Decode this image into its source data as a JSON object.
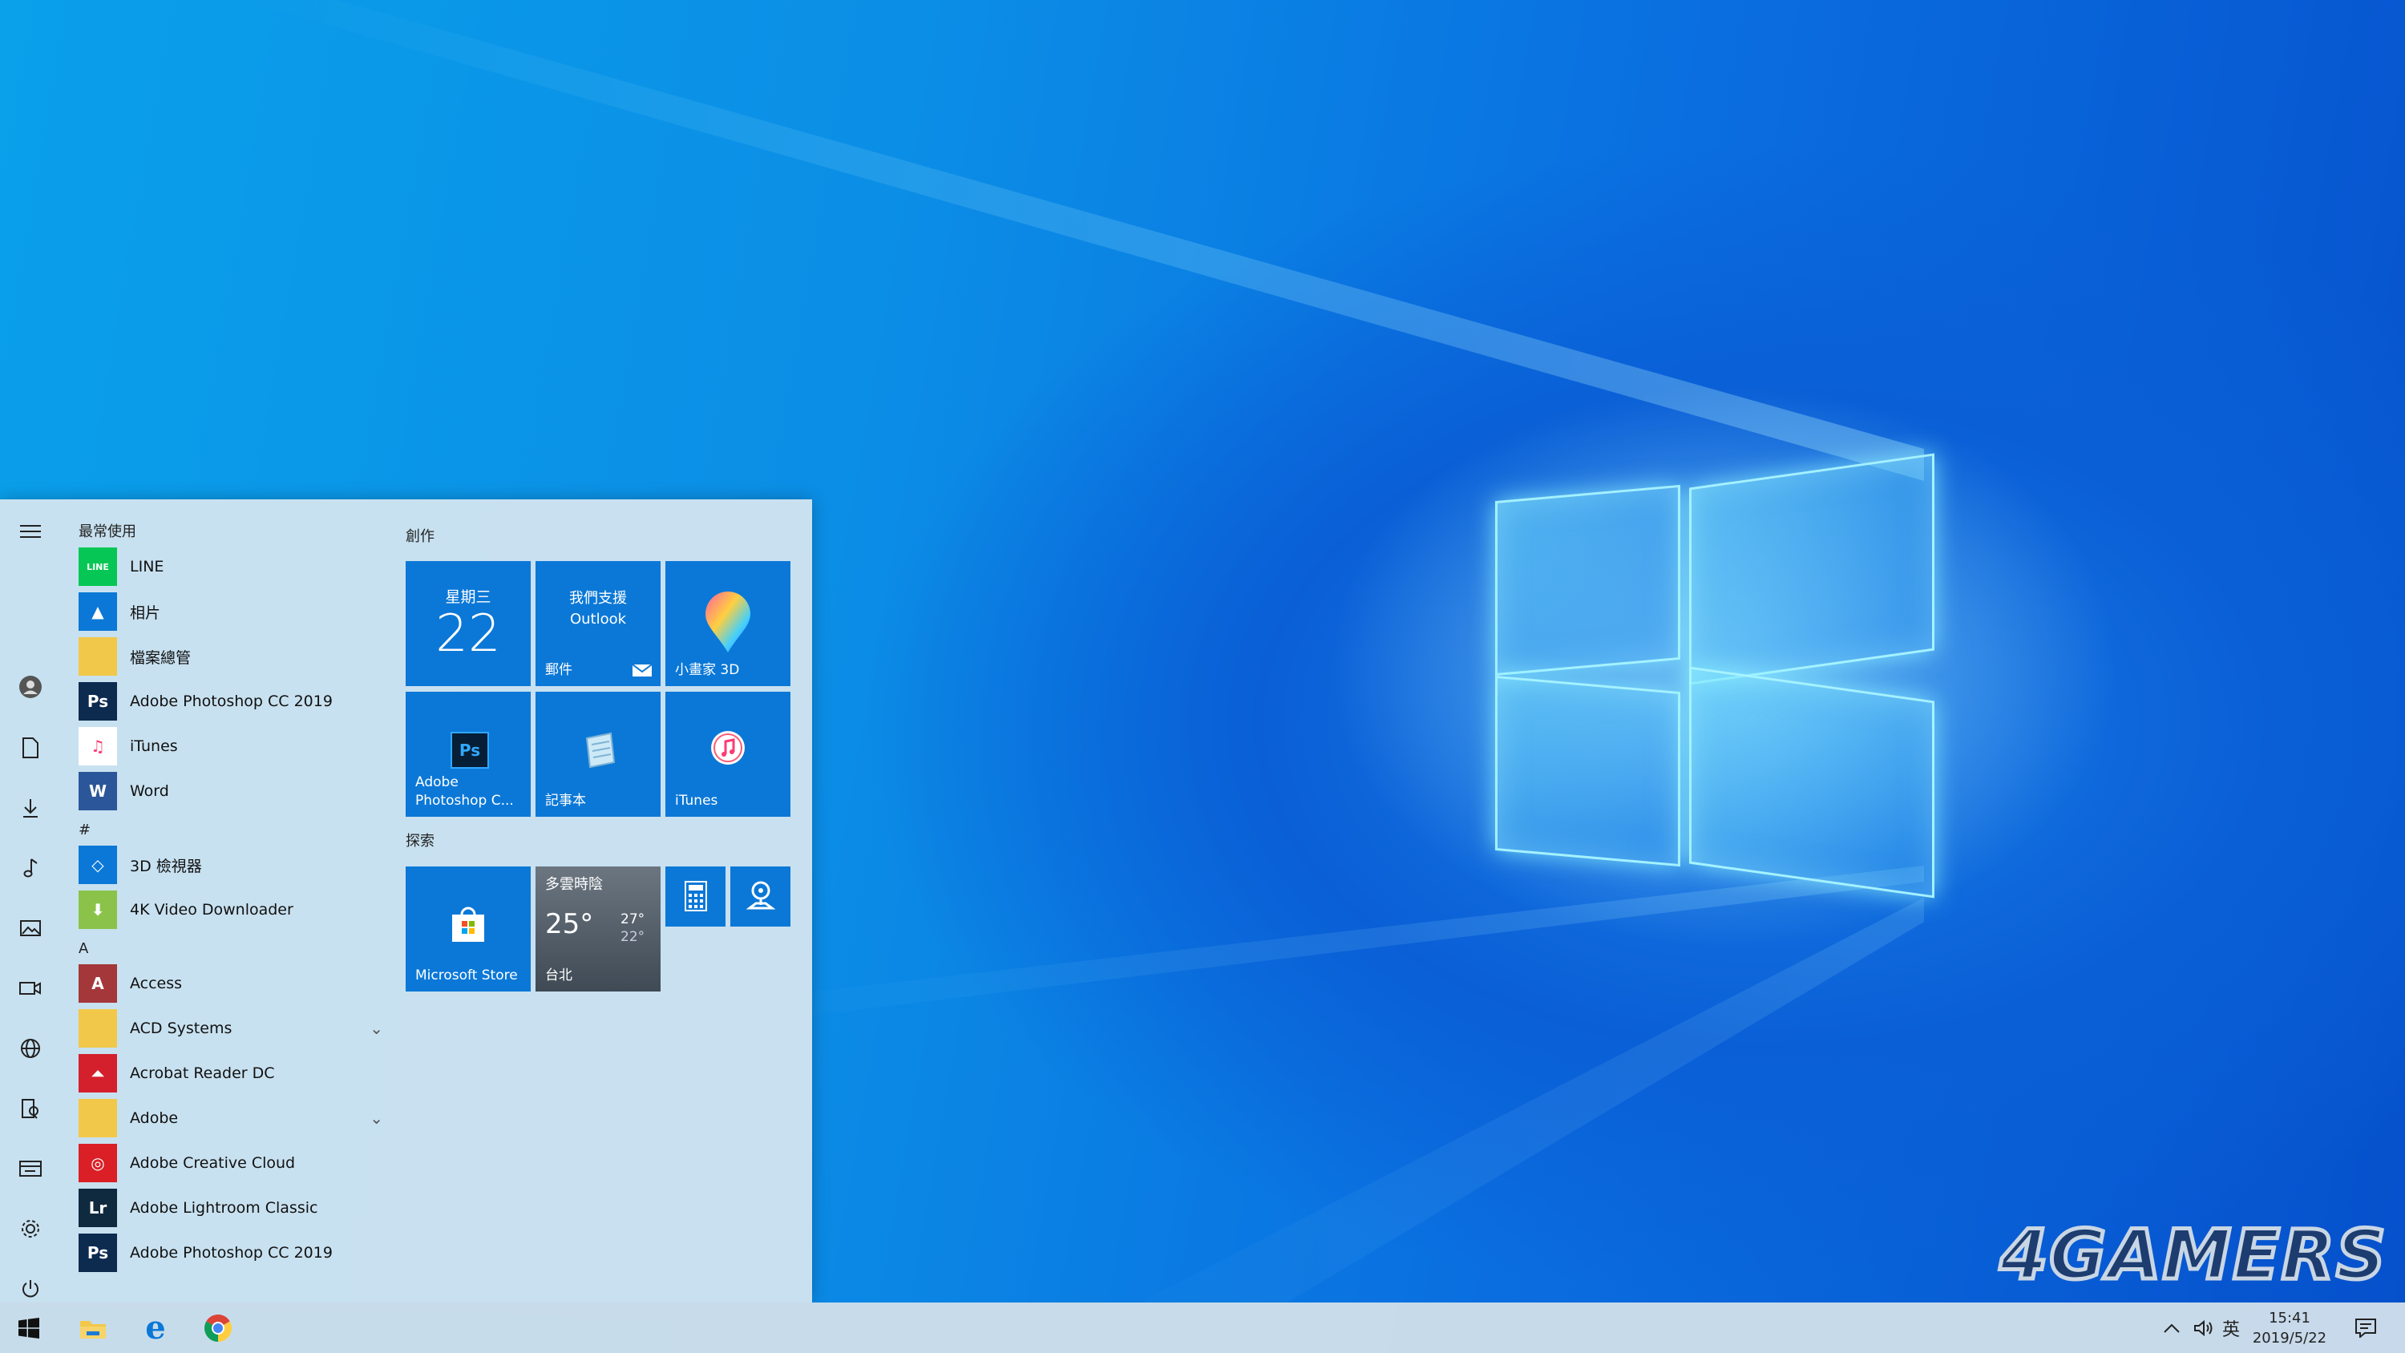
{
  "start_menu": {
    "most_used_header": "最常使用",
    "most_used": [
      {
        "label": "LINE",
        "icon": "line-icon",
        "color": "#06c755"
      },
      {
        "label": "相片",
        "icon": "photos-icon",
        "color": "#0b78d7"
      },
      {
        "label": "檔案總管",
        "icon": "folder-icon",
        "color": "#f2c84b"
      },
      {
        "label": "Adobe Photoshop CC 2019",
        "icon": "photoshop-icon",
        "color": "#0d2a4f"
      },
      {
        "label": "iTunes",
        "icon": "itunes-icon",
        "color": "#ffffff"
      },
      {
        "label": "Word",
        "icon": "word-icon",
        "color": "#2b579a"
      }
    ],
    "hash_header": "#",
    "hash_items": [
      {
        "label": "3D 檢視器",
        "icon": "cube-icon",
        "color": "#0b78d7"
      },
      {
        "label": "4K Video Downloader",
        "icon": "downloader-icon",
        "color": "#8bc34a"
      }
    ],
    "a_header": "A",
    "a_items": [
      {
        "label": "Access",
        "icon": "access-icon",
        "color": "#a4373a",
        "expand": false
      },
      {
        "label": "ACD Systems",
        "icon": "folder-icon",
        "color": "#f2c84b",
        "expand": true
      },
      {
        "label": "Acrobat Reader DC",
        "icon": "acrobat-icon",
        "color": "#d4202c",
        "expand": false
      },
      {
        "label": "Adobe",
        "icon": "folder-icon",
        "color": "#f2c84b",
        "expand": true
      },
      {
        "label": "Adobe Creative Cloud",
        "icon": "creative-cloud-icon",
        "color": "#da1f26",
        "expand": false
      },
      {
        "label": "Adobe Lightroom Classic",
        "icon": "lightroom-icon",
        "color": "#0f2a3f",
        "expand": false
      },
      {
        "label": "Adobe Photoshop CC 2019",
        "icon": "photoshop-icon",
        "color": "#0d2a4f",
        "expand": false
      }
    ],
    "group_create": "創作",
    "group_explore": "探索",
    "tiles": {
      "calendar_day": "星期三",
      "calendar_date": "22",
      "mail_line1": "我們支援",
      "mail_line2": "Outlook",
      "mail_label": "郵件",
      "paint3d_label": "小畫家 3D",
      "photoshop_line1": "Adobe",
      "photoshop_line2": "Photoshop C...",
      "notepad_label": "記事本",
      "itunes_label": "iTunes",
      "store_label": "Microsoft Store",
      "weather_condition": "多雲時陰",
      "weather_temp": "25°",
      "weather_high": "27°",
      "weather_low": "22°",
      "weather_city": "台北"
    }
  },
  "taskbar": {
    "ime": "英",
    "time": "15:41",
    "date": "2019/5/22"
  },
  "watermark": "4GAMERS"
}
